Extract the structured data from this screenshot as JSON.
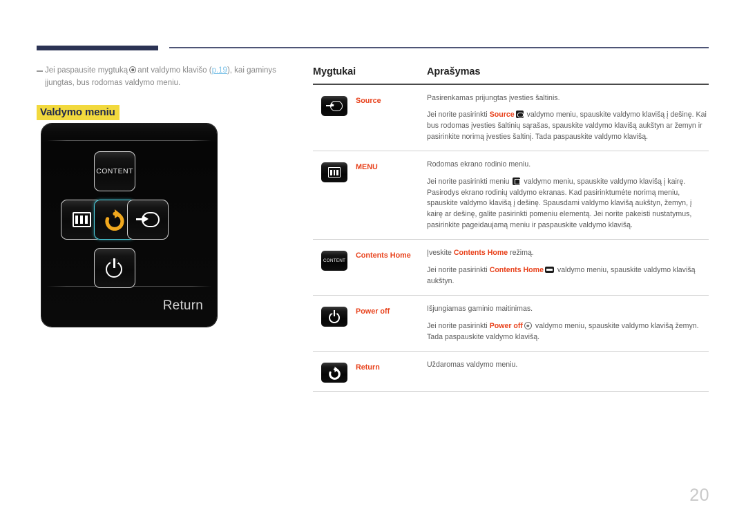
{
  "page_number": "20",
  "intro": {
    "text_before_icon": "Jei paspausite mygtuką",
    "icon": "joystick-icon",
    "text_after_icon": "ant valdymo klavišo (",
    "link": "p.19",
    "text_after_link": "), kai gaminys įjungtas, bus rodomas valdymo meniu."
  },
  "section_title": "Valdymo meniu",
  "device": {
    "content_key_label": "CONTENT",
    "menu_key": "menu-icon",
    "return_key": "return-arrow-icon",
    "source_key": "source-icon",
    "power_key": "power-icon",
    "footer_label": "Return",
    "highlight_color": "#4fd6e6",
    "return_arrow_color": "#f0a81e"
  },
  "table": {
    "header": {
      "buttons": "Mygtukai",
      "description": "Aprašymas"
    },
    "rows": [
      {
        "icon": "source-icon",
        "name": "Source",
        "desc_1": "Pasirenkamas prijungtas įvesties šaltinis.",
        "desc_2_a": "Jei norite pasirinkti ",
        "desc_2_kw": "Source",
        "desc_2_b": " valdymo meniu, spauskite valdymo klavišą į dešinę. Kai bus rodomas įvesties šaltinių sąrašas, spauskite valdymo klavišą aukštyn ar žemyn ir pasirinkite norimą įvesties šaltinį. Tada paspauskite valdymo klavišą."
      },
      {
        "icon": "menu-icon",
        "name": "MENU",
        "desc_1": "Rodomas ekrano rodinio meniu.",
        "desc_2_a": "Jei norite pasirinkti meniu ",
        "desc_2_kw": "",
        "desc_2_b": " valdymo meniu, spauskite valdymo klavišą į kairę. Pasirodys ekrano rodinių valdymo ekranas. Kad pasirinktumėte norimą meniu, spauskite valdymo klavišą į dešinę. Spausdami valdymo klavišą aukštyn, žemyn, į kairę ar dešinę, galite pasirinkti pomeniu elementą. Jei norite pakeisti nustatymus, pasirinkite pageidaujamą meniu ir paspauskite valdymo klavišą."
      },
      {
        "icon": "content-icon",
        "name": "Contents Home",
        "desc_1_a": "Įveskite ",
        "desc_1_kw": "Contents Home",
        "desc_1_b": " režimą.",
        "desc_2_a": "Jei norite pasirinkti ",
        "desc_2_kw": "Contents Home",
        "desc_2_b": " valdymo meniu, spauskite valdymo klavišą aukštyn."
      },
      {
        "icon": "power-icon",
        "name": "Power off",
        "desc_1": "Išjungiamas gaminio maitinimas.",
        "desc_2_a": "Jei norite pasirinkti ",
        "desc_2_kw": "Power off",
        "desc_2_b": " valdymo meniu, spauskite valdymo klavišą žemyn. Tada paspauskite valdymo klavišą."
      },
      {
        "icon": "return-arrow-icon",
        "name": "Return",
        "desc_1": "Uždaromas valdymo meniu."
      }
    ]
  },
  "colors": {
    "accent_red": "#e8421c",
    "navy": "#2b3354",
    "highlight_yellow": "#f2d93d",
    "link_blue": "#7fc3e8"
  }
}
